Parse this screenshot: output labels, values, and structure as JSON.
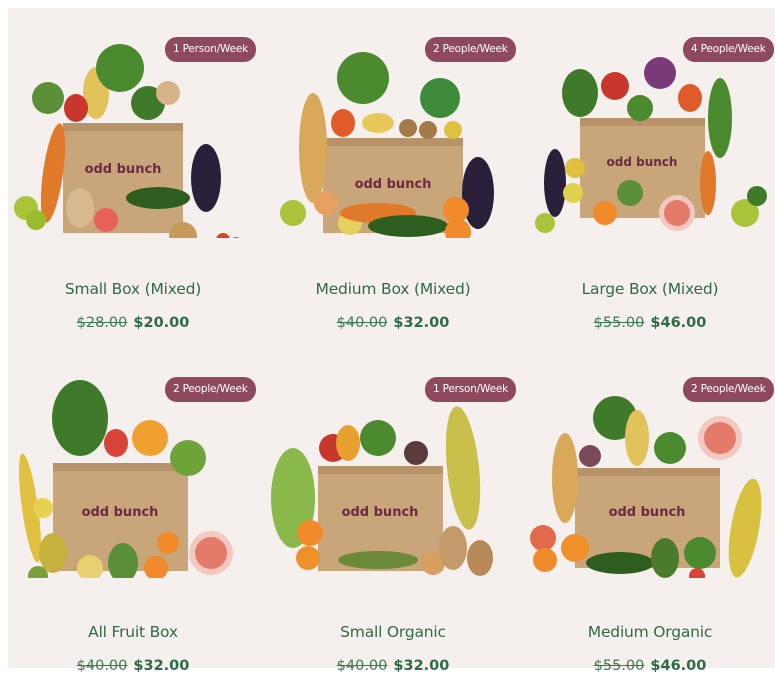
{
  "products": [
    {
      "badge": "1 Person/Week",
      "title": "Small Box (Mixed)",
      "old_price": "$28.00",
      "new_price": "$20.00",
      "brand": "odd bunch"
    },
    {
      "badge": "2 People/Week",
      "title": "Medium Box (Mixed)",
      "old_price": "$40.00",
      "new_price": "$32.00",
      "brand": "odd bunch"
    },
    {
      "badge": "4 People/Week",
      "title": "Large Box (Mixed)",
      "old_price": "$55.00",
      "new_price": "$46.00",
      "brand": "odd bunch"
    },
    {
      "badge": "2 People/Week",
      "title": "All Fruit Box",
      "old_price": "$40.00",
      "new_price": "$32.00",
      "brand": "odd bunch"
    },
    {
      "badge": "1 Person/Week",
      "title": "Small Organic",
      "old_price": "$40.00",
      "new_price": "$32.00",
      "brand": "odd bunch"
    },
    {
      "badge": "2 People/Week",
      "title": "Medium Organic",
      "old_price": "$55.00",
      "new_price": "$46.00",
      "brand": "odd bunch"
    }
  ],
  "colors": {
    "background": "#f5f0ed",
    "badge": "#8e4a5c",
    "text_green": "#2f6b45",
    "box_kraft": "#c9a57a",
    "logo_purple": "#6b2a45"
  }
}
